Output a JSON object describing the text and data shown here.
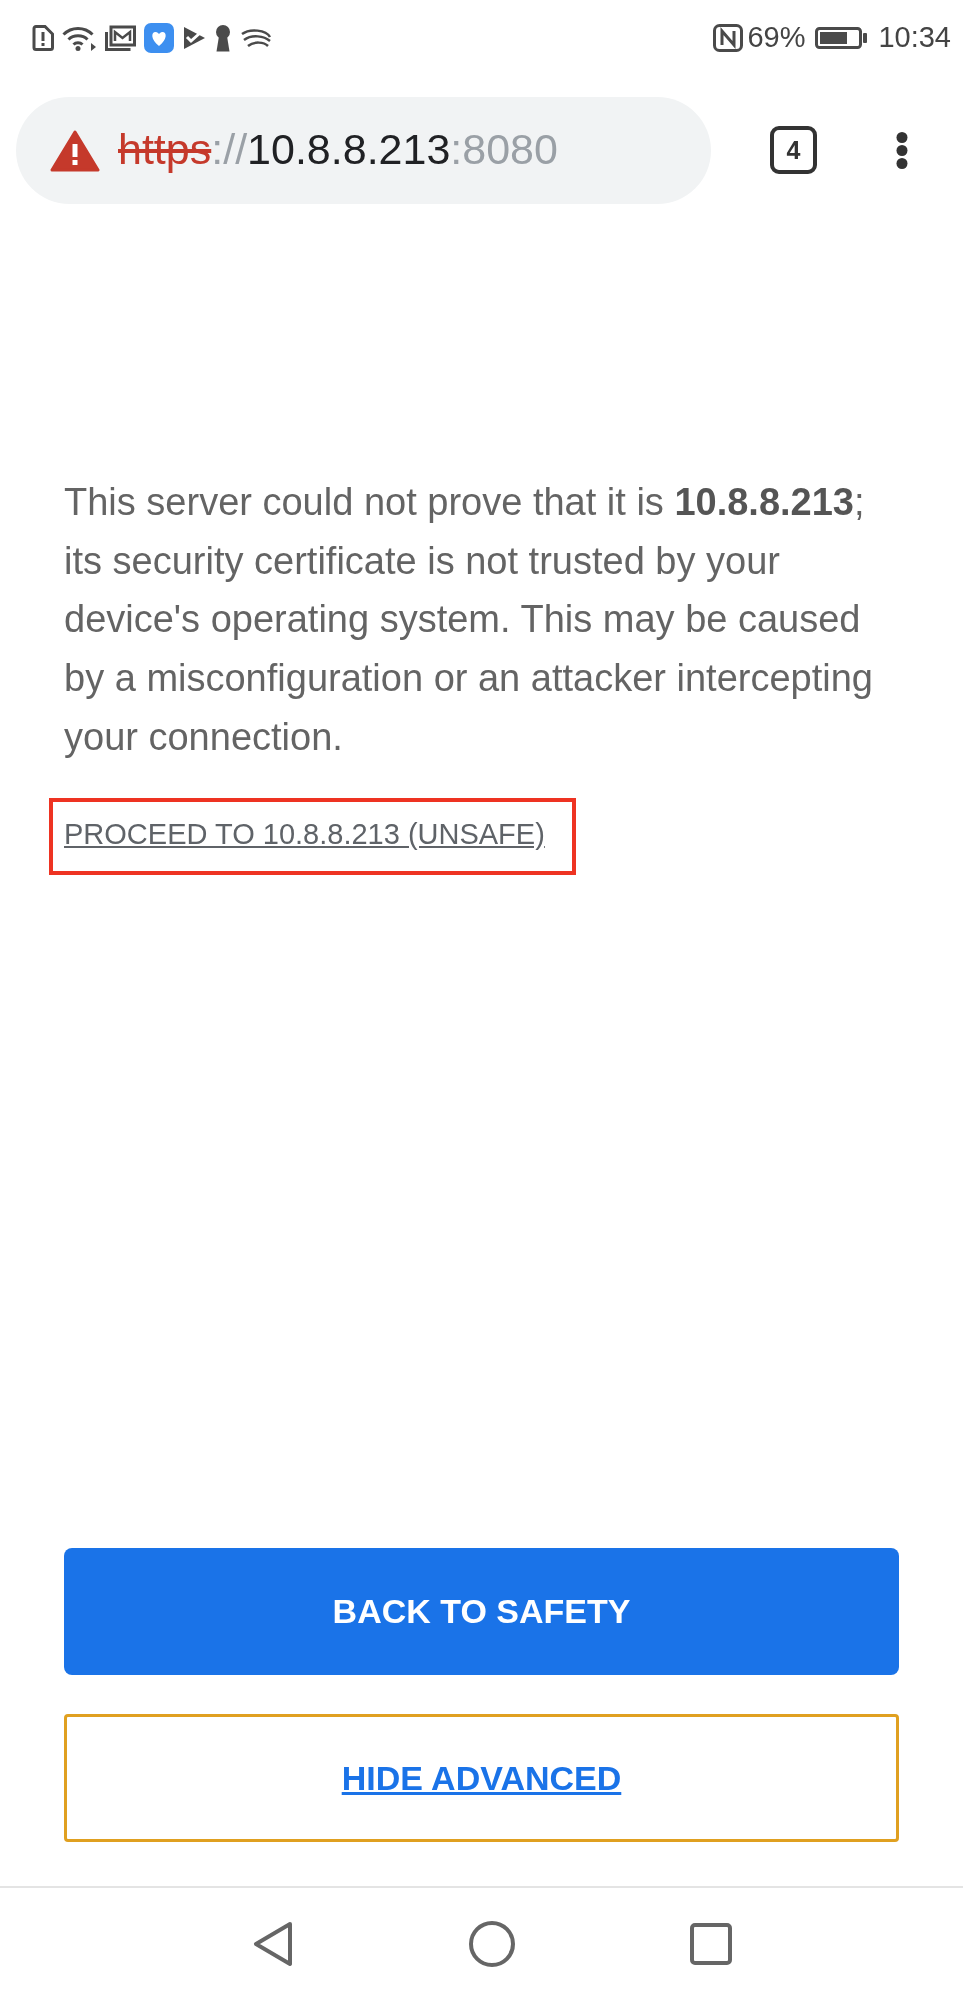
{
  "status_bar": {
    "battery_percent": "69%",
    "time": "10:34"
  },
  "address_bar": {
    "insecure": true,
    "url_parts": [
      {
        "text": "https",
        "kind": "scheme"
      },
      {
        "text": "://",
        "kind": "muted"
      },
      {
        "text": "10.8.8.213",
        "kind": "host"
      },
      {
        "text": ":8080",
        "kind": "muted"
      }
    ],
    "tab_count": "4"
  },
  "message": {
    "text": "This server could not prove that it is **10.8.8.213**; its security certificate is not trusted by your device's operating system. This may be caused by a misconfiguration or an attacker intercepting your connection."
  },
  "proceed_link": {
    "text": "PROCEED TO 10.8.8.213 (UNSAFE)",
    "highlighted": true
  },
  "buttons": [
    {
      "label": "BACK TO SAFETY",
      "kind": "primary",
      "focused": false
    },
    {
      "label": "HIDE ADVANCED",
      "kind": "link",
      "focused": true
    }
  ]
}
